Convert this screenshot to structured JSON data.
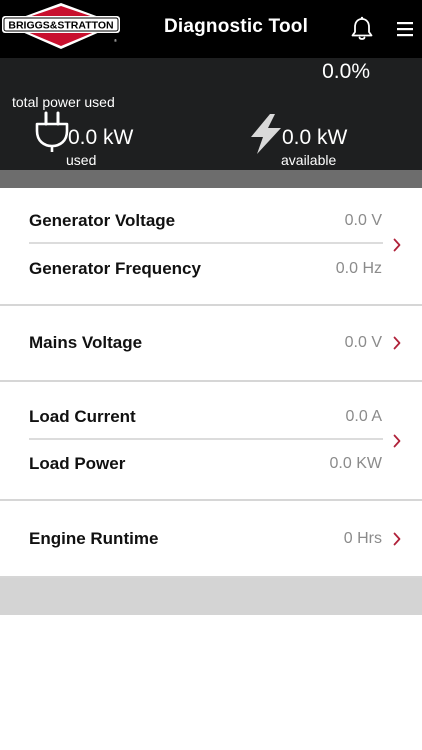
{
  "header": {
    "title": "Diagnostic Tool",
    "logo_text": "BRIGGS&STRATTON",
    "logo_icon": "briggs-stratton-logo",
    "bell_icon": "bell-icon",
    "menu_icon": "hamburger-menu-icon"
  },
  "power": {
    "percent": "0.0%",
    "total_label": "total power used",
    "used_value": "0.0 kW",
    "used_label": "used",
    "available_value": "0.0 kW",
    "available_label": "available",
    "used_icon": "plug-icon",
    "available_icon": "lightning-bolt-icon"
  },
  "rows": [
    {
      "label": "Generator Voltage",
      "value": "0.0 V"
    },
    {
      "label": "Generator Frequency",
      "value": "0.0 Hz"
    },
    {
      "label": "Mains Voltage",
      "value": "0.0 V"
    },
    {
      "label": "Load Current",
      "value": "0.0 A"
    },
    {
      "label": "Load Power",
      "value": "0.0 KW"
    },
    {
      "label": "Engine Runtime",
      "value": "0 Hrs"
    }
  ],
  "colors": {
    "header_bg": "#000000",
    "panel_bg": "#1e1f20",
    "accent_red": "#b0223a",
    "value_gray": "#8b8b8b"
  }
}
